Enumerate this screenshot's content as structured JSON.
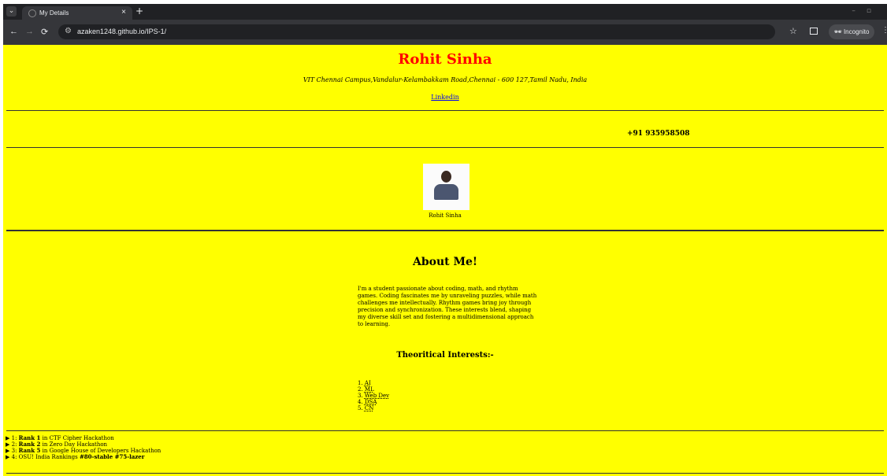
{
  "browser": {
    "tab_title": "My Details",
    "url": "azaken1248.github.io/IPS-1/",
    "incognito_label": "Incognito"
  },
  "profile": {
    "name": "Rohit Sinha",
    "address": "VIT Chennai Campus,Vandalur-Kelambakkam Road,Chennai - 600 127,Tamil Nadu, India",
    "link_text": "Linkedin",
    "phone": "+91 935958508",
    "photo_caption": "Rohit Sinha"
  },
  "about": {
    "heading": "About Me!",
    "paragraph": "I'm a student passionate about coding, math, and rhythm games. Coding fascinates me by unraveling puzzles, while math challenges me intellectually. Rhythm games bring joy through precision and synchronization. These interests blend, shaping my diverse skill set and fostering a multidimensional approach to learning.",
    "interests_heading": "Theoritical Interests:-",
    "interests": [
      {
        "num": "1.",
        "text": "AI"
      },
      {
        "num": "2.",
        "text": "ML"
      },
      {
        "num": "3.",
        "text": "Web Dev"
      },
      {
        "num": "4.",
        "text": "DSA"
      },
      {
        "num": "5.",
        "text": "CN"
      }
    ]
  },
  "achievements": [
    {
      "prefix": "1: ",
      "bold": "Rank 1",
      "rest": " in CTF Cipher Hackathon"
    },
    {
      "prefix": "2: ",
      "bold": "Rank 2",
      "rest": " in Zero Day Hackathon"
    },
    {
      "prefix": "3: ",
      "bold": "Rank 5",
      "rest": " in Google House of Developers Hackathon"
    },
    {
      "prefix": "4: OSU! India Rankings ",
      "bold": "#80-stable #75-lazer",
      "rest": ""
    }
  ]
}
